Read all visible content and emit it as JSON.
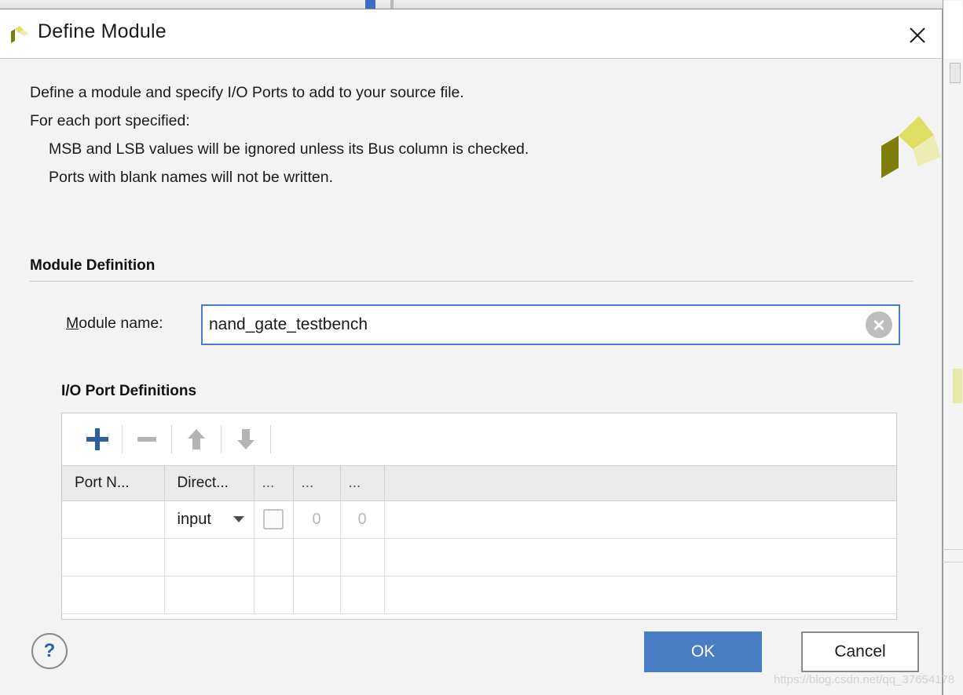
{
  "window": {
    "title": "Define Module",
    "logo_icon": "vivado-pinwheel-logo",
    "close_icon": "close-icon"
  },
  "description": {
    "line1": "Define a module and specify I/O Ports to add to your source file.",
    "line2": "For each port specified:",
    "line3": "MSB and LSB values will be ignored unless its Bus column is checked.",
    "line4": "Ports with blank names will not be written."
  },
  "module_definition": {
    "section_title": "Module Definition",
    "name_label_mnemonic": "M",
    "name_label_rest": "odule name:",
    "name_value": "nand_gate_testbench",
    "name_placeholder": "",
    "clear_icon": "clear-circle-x-icon"
  },
  "io_ports": {
    "section_title": "I/O Port Definitions",
    "toolbar": {
      "add_icon": "plus-icon",
      "remove_icon": "minus-icon",
      "move_up_icon": "arrow-up-icon",
      "move_down_icon": "arrow-down-icon"
    },
    "columns": [
      "Port N...",
      "Direct...",
      "...",
      "...",
      "..."
    ],
    "rows": [
      {
        "port_name": "",
        "direction": "input",
        "bus_checked": false,
        "msb": "0",
        "lsb": "0"
      },
      {
        "port_name": "",
        "direction": "",
        "bus_checked": false,
        "msb": "",
        "lsb": ""
      },
      {
        "port_name": "",
        "direction": "",
        "bus_checked": false,
        "msb": "",
        "lsb": ""
      }
    ]
  },
  "footer": {
    "help_label": "?",
    "ok_label": "OK",
    "cancel_label": "Cancel"
  },
  "watermark": {
    "text": "https://blog.csdn.net/qq_37654178"
  },
  "colors": {
    "accent_blue": "#4a7ec4",
    "toolbar_plus_blue": "#2f5f9e",
    "dialog_bg": "#f3f3f3",
    "logo_dark": "#7d7d0c",
    "logo_mid": "#dede62",
    "logo_light": "#ececb4"
  }
}
